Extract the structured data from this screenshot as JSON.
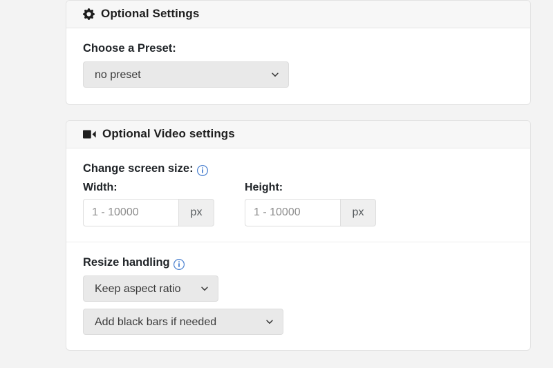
{
  "colors": {
    "page_background": "#f3f3f3",
    "card_background": "#ffffff",
    "card_header_background": "#f7f7f7",
    "border": "#e3e3e3",
    "text": "#212529",
    "muted_text": "#8d8d8d",
    "info_icon": "#0d6efd",
    "select_background": "#e9e9e9",
    "addon_background": "#efefef"
  },
  "optional_settings": {
    "icon": "gear-icon",
    "title": "Optional Settings",
    "preset": {
      "label": "Choose a Preset:",
      "selected": "no preset",
      "chevron": "chevron-down-icon"
    }
  },
  "optional_video_settings": {
    "icon": "video-camera-icon",
    "title": "Optional Video settings",
    "screen_size": {
      "label": "Change screen size:",
      "info_icon": "info-circle-icon",
      "width": {
        "label": "Width:",
        "value": "",
        "placeholder": "1 - 10000",
        "unit": "px"
      },
      "height": {
        "label": "Height:",
        "value": "",
        "placeholder": "1 - 10000",
        "unit": "px"
      }
    },
    "resize_handling": {
      "label": "Resize handling",
      "info_icon": "info-circle-icon",
      "aspect_ratio": {
        "selected": "Keep aspect ratio",
        "chevron": "chevron-down-icon"
      },
      "black_bars": {
        "selected": "Add black bars if needed",
        "chevron": "chevron-down-icon"
      }
    }
  }
}
